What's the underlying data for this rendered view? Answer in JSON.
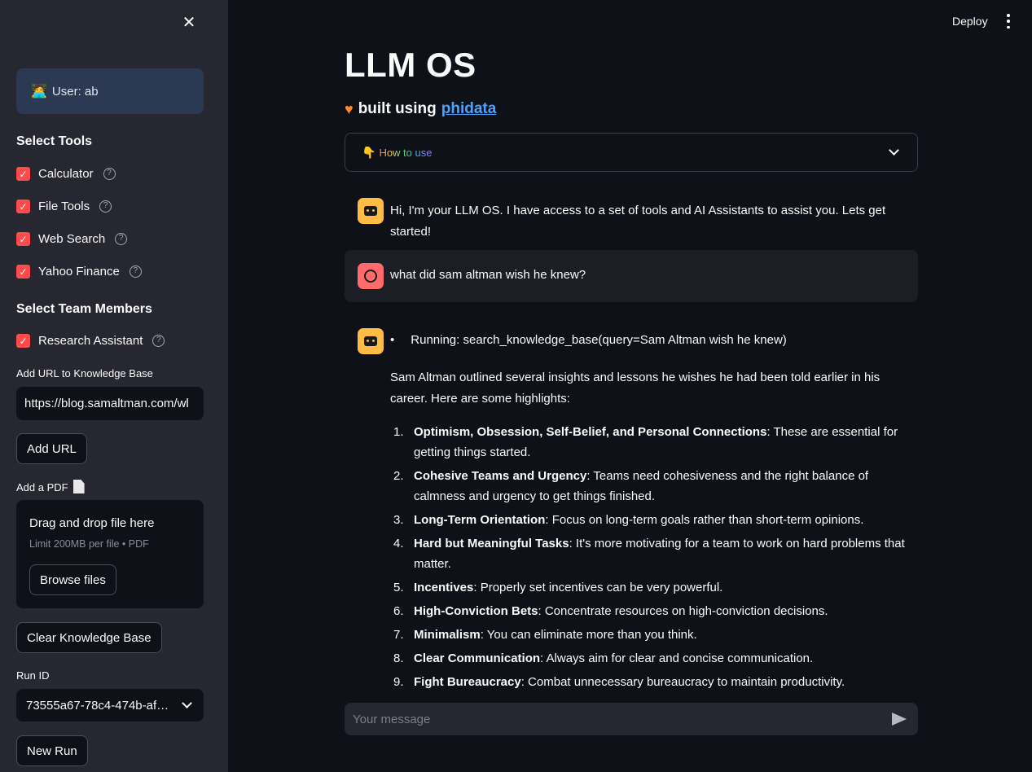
{
  "header": {
    "deploy_label": "Deploy"
  },
  "sidebar": {
    "user_label": "User: ab",
    "tools_title": "Select Tools",
    "tools": [
      {
        "label": "Calculator",
        "checked": true
      },
      {
        "label": "File Tools",
        "checked": true
      },
      {
        "label": "Web Search",
        "checked": true
      },
      {
        "label": "Yahoo Finance",
        "checked": true
      }
    ],
    "team_title": "Select Team Members",
    "team": [
      {
        "label": "Research Assistant",
        "checked": true
      }
    ],
    "url_label": "Add URL to Knowledge Base",
    "url_value": "https://blog.samaltman.com/wl",
    "add_url_button": "Add URL",
    "pdf_label": "Add a PDF",
    "dropzone": {
      "title": "Drag and drop file here",
      "limit": "Limit 200MB per file • PDF",
      "browse_button": "Browse files"
    },
    "clear_kb_button": "Clear Knowledge Base",
    "run_id_label": "Run ID",
    "run_id_value": "73555a67-78c4-474b-af…",
    "new_run_button": "New Run"
  },
  "main": {
    "title": "LLM OS",
    "subtitle_prefix": "built using",
    "subtitle_link": "phidata",
    "expander_label": "How to use",
    "messages": {
      "greeting": "Hi, I'm your LLM OS. I have access to a set of tools and AI Assistants to assist you. Lets get started!",
      "user_question": "what did sam altman wish he knew?",
      "running_bullet": "•",
      "running": "Running: search_knowledge_base(query=Sam Altman wish he knew)",
      "intro": "Sam Altman outlined several insights and lessons he wishes he had been told earlier in his career. Here are some highlights:",
      "items": [
        {
          "num": "1.",
          "bold": "Optimism, Obsession, Self-Belief, and Personal Connections",
          "text": ": These are essential for getting things started."
        },
        {
          "num": "2.",
          "bold": "Cohesive Teams and Urgency",
          "text": ": Teams need cohesiveness and the right balance of calmness and urgency to get things finished."
        },
        {
          "num": "3.",
          "bold": "Long-Term Orientation",
          "text": ": Focus on long-term goals rather than short-term opinions."
        },
        {
          "num": "4.",
          "bold": "Hard but Meaningful Tasks",
          "text": ": It's more motivating for a team to work on hard problems that matter."
        },
        {
          "num": "5.",
          "bold": "Incentives",
          "text": ": Properly set incentives can be very powerful."
        },
        {
          "num": "6.",
          "bold": "High-Conviction Bets",
          "text": ": Concentrate resources on high-conviction decisions."
        },
        {
          "num": "7.",
          "bold": "Minimalism",
          "text": ": You can eliminate more than you think."
        },
        {
          "num": "8.",
          "bold": "Clear Communication",
          "text": ": Always aim for clear and concise communication."
        },
        {
          "num": "9.",
          "bold": "Fight Bureaucracy",
          "text": ": Combat unnecessary bureaucracy to maintain productivity."
        }
      ]
    },
    "chat_placeholder": "Your message"
  }
}
